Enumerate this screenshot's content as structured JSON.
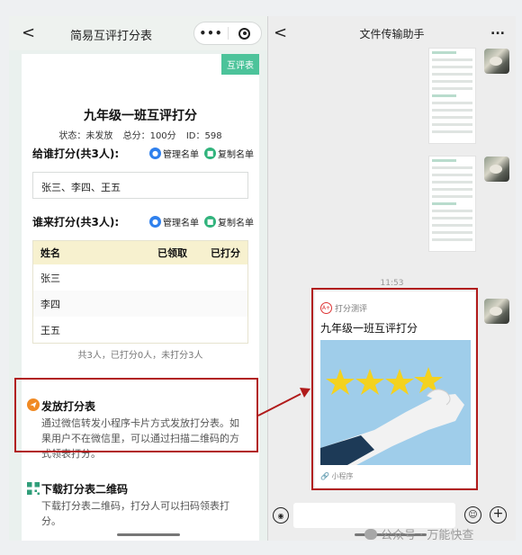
{
  "left": {
    "nav": {
      "back": "<",
      "title": "简易互评打分表",
      "menu": "•••"
    },
    "tag": "互评表",
    "form_title": "九年级一班互评打分",
    "meta": {
      "status": "状态：未发放",
      "score": "总分：100分",
      "id": "ID：598"
    },
    "sec_give": {
      "label": "给谁打分(共3人):",
      "manage": "管理名单",
      "copy": "复制名单"
    },
    "names": "张三、李四、王五",
    "sec_from": {
      "label": "谁来打分(共3人):",
      "manage": "管理名单",
      "copy": "复制名单"
    },
    "table": {
      "headers": {
        "name": "姓名",
        "received": "已领取",
        "scored": "已打分"
      },
      "rows": [
        "张三",
        "李四",
        "王五"
      ]
    },
    "summary": "共3人，已打分0人，未打分3人",
    "features": [
      {
        "title": "发放打分表",
        "desc": "通过微信转发小程序卡片方式发放打分表。如果用户不在微信里，可以通过扫描二维码的方式领表打分。"
      },
      {
        "title": "下载打分表二维码",
        "desc": "下载打分表二维码，打分人可以扫码领表打分。"
      }
    ]
  },
  "right": {
    "nav": {
      "back": "<",
      "title": "文件传输助手",
      "more": "..."
    },
    "time": "11:53",
    "mini": {
      "app": "打分测评",
      "title": "九年级一班互评打分",
      "footer": "小程序"
    }
  },
  "watermark": "公众号 · 万能快查",
  "colors": {
    "accent": "#4cc39a",
    "highlight": "#b11b1b",
    "link_blue": "#2f80ed",
    "header_yellow": "#f7f1cf"
  }
}
